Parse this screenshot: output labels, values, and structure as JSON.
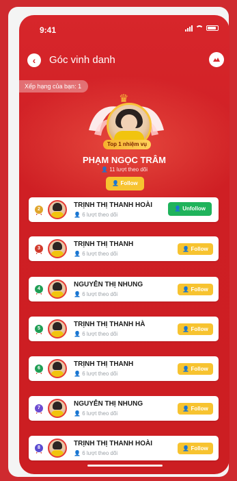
{
  "status_bar": {
    "time": "9:41"
  },
  "header": {
    "title": "Góc vinh danh"
  },
  "rank_tag": "Xếp hạng của bạn: 1",
  "hero": {
    "badge": "Top 1 nhiệm vụ",
    "name": "PHẠM NGỌC TRÂM",
    "follow_count": "11 lượt theo dõi",
    "follow_button": "Follow"
  },
  "leaderboard": [
    {
      "rank": "2",
      "name": "TRỊNH THỊ THANH HOÀI",
      "sub": "6 lượt theo dõi",
      "button": "Unfollow"
    },
    {
      "rank": "3",
      "name": "TRỊNH THỊ THANH",
      "sub": "6 lượt theo dõi",
      "button": "Follow"
    },
    {
      "rank": "4",
      "name": "NGUYỄN THỊ NHUNG",
      "sub": "6 lượt theo dõi",
      "button": "Follow"
    },
    {
      "rank": "5",
      "name": "TRỊNH THỊ THANH HÀ",
      "sub": "6 lượt theo dõi",
      "button": "Follow"
    },
    {
      "rank": "6",
      "name": "TRỊNH THỊ THANH",
      "sub": "6 lượt theo dõi",
      "button": "Follow"
    },
    {
      "rank": "7",
      "name": "NGUYỄN THỊ NHUNG",
      "sub": "6 lượt theo dõi",
      "button": "Follow"
    },
    {
      "rank": "8",
      "name": "TRỊNH THỊ THANH HOÀI",
      "sub": "6 lượt theo dõi",
      "button": "Follow"
    }
  ],
  "colors": {
    "primary": "#d7262b",
    "gold": "#f7c330",
    "unfollow": "#1fb35b",
    "medal_2": "#e0a52a",
    "medal_3": "#d13a2c",
    "medal_4": "#1f9e55",
    "medal_5": "#1f9e55",
    "medal_6": "#1f9e55",
    "medal_7": "#6c4bd1",
    "medal_8": "#5a4bd1"
  }
}
